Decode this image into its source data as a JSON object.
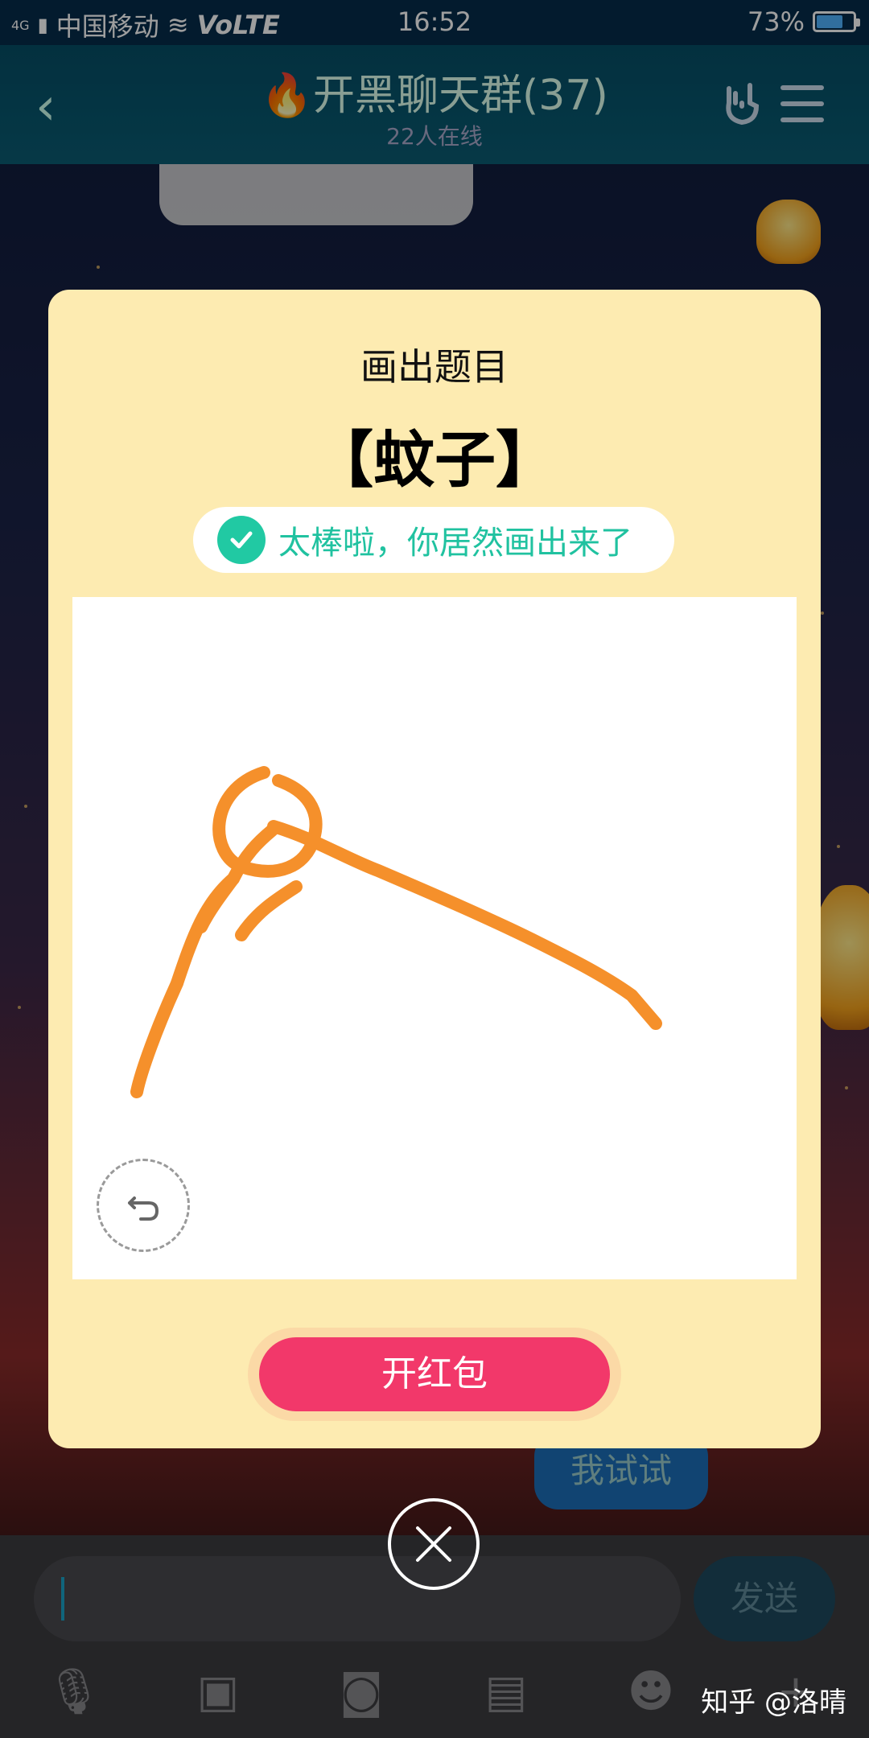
{
  "status_bar": {
    "network": "4G",
    "carrier": "中国移动",
    "volte": "VoLTE",
    "time": "16:52",
    "battery_percent": "73%",
    "battery_level": 0.73
  },
  "header": {
    "back_icon": "chevron-left-icon",
    "title": "🔥开黑聊天群(37)",
    "online": "22人在线",
    "hand_icon": "rock-hand-icon",
    "menu_icon": "menu-icon"
  },
  "chat": {
    "try_button": "我试试"
  },
  "dialog": {
    "title": "画出题目",
    "word": "【蚊子】",
    "success_message": "太棒啦，你居然画出来了",
    "undo_icon": "undo-icon",
    "open_button": "开红包",
    "close_icon": "close-icon",
    "stroke_color": "#f5902b"
  },
  "input_bar": {
    "send_label": "发送",
    "tools": [
      "microphone-icon",
      "image-icon",
      "camera-icon",
      "red-packet-icon",
      "emoji-icon",
      "plus-icon"
    ]
  },
  "watermark": "知乎 @洛晴",
  "colors": {
    "dialog_bg": "#fdebb1",
    "accent_green": "#21c9a3",
    "button_pink": "#f2386a"
  }
}
